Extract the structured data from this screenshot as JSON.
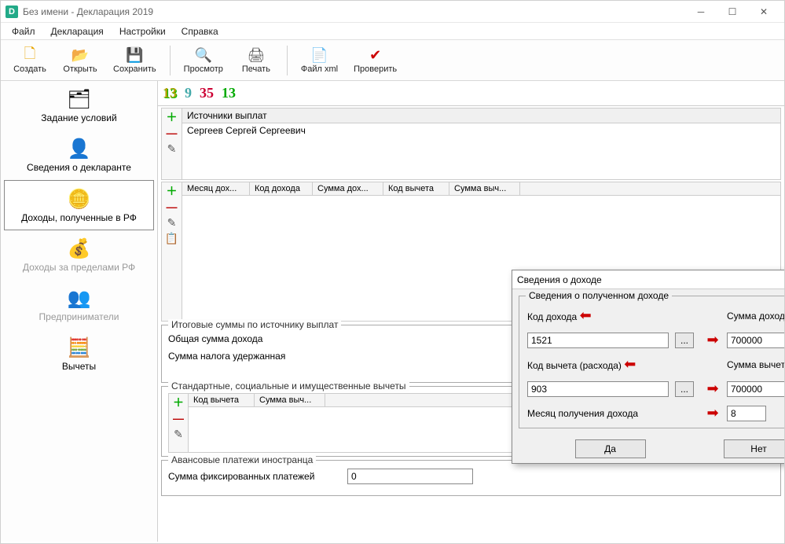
{
  "window": {
    "title": "Без имени - Декларация 2019"
  },
  "menu": {
    "file": "Файл",
    "decl": "Декларация",
    "settings": "Настройки",
    "help": "Справка"
  },
  "toolbar": {
    "create": "Создать",
    "open": "Открыть",
    "save": "Сохранить",
    "preview": "Просмотр",
    "print": "Печать",
    "xml": "Файл xml",
    "check": "Проверить"
  },
  "sidenav": {
    "conditions": "Задание условий",
    "declarant": "Сведения о декларанте",
    "income_rf": "Доходы, полученные в РФ",
    "income_abroad": "Доходы за пределами РФ",
    "entrepreneurs": "Предприниматели",
    "deductions": "Вычеты"
  },
  "rate_tabs": {
    "r13a": "13",
    "r9": "9",
    "r35": "35",
    "r13b": "13"
  },
  "sources": {
    "header": "Источники выплат",
    "row1": "Сергеев Сергей Сергеевич"
  },
  "income_table": {
    "col_month": "Месяц дох...",
    "col_code": "Код дохода",
    "col_sum": "Сумма дох...",
    "col_ded_code": "Код вычета",
    "col_ded_sum": "Сумма выч..."
  },
  "totals": {
    "group": "Итоговые суммы по источнику выплат",
    "total_income": "Общая сумма дохода",
    "tax_withheld": "Сумма налога удержанная"
  },
  "deductions_block": {
    "group": "Стандартные, социальные и имущественные вычеты",
    "col_code": "Код вычета",
    "col_sum": "Сумма выч..."
  },
  "advance": {
    "group": "Авансовые платежи иностранца",
    "label": "Сумма фиксированных платежей",
    "value": "0"
  },
  "dialog": {
    "title": "Сведения о доходе",
    "group": "Сведения о полученном доходе",
    "income_code_label": "Код дохода",
    "income_code_value": "1521",
    "income_sum_label": "Сумма дохода",
    "income_sum_value": "700000",
    "deduction_code_label": "Код вычета (расхода)",
    "deduction_code_value": "903",
    "deduction_sum_label": "Сумма вычета (расхода)",
    "deduction_sum_value": "700000",
    "month_label": "Месяц получения дохода",
    "month_value": "8",
    "ok": "Да",
    "cancel": "Нет"
  }
}
